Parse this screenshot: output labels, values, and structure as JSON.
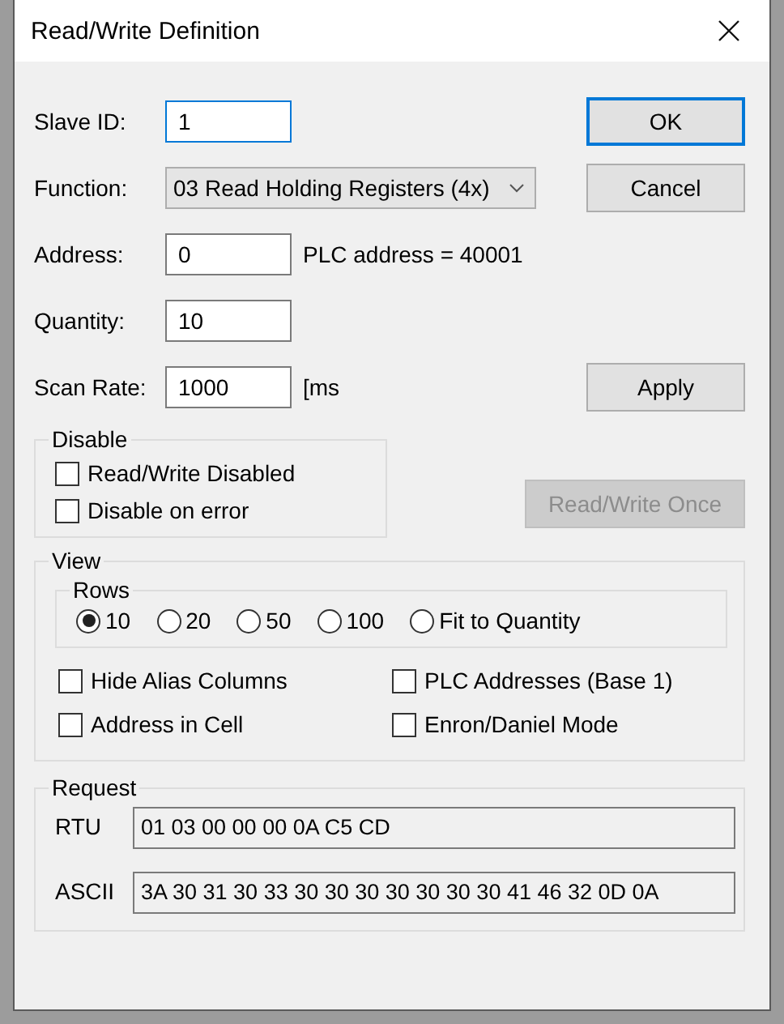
{
  "window": {
    "title": "Read/Write Definition"
  },
  "fields": [
    {
      "label": "Slave ID:",
      "kind": "text",
      "value": "1",
      "focused": true,
      "button": {
        "label": "OK",
        "default": true
      }
    },
    {
      "label": "Function:",
      "kind": "select",
      "value": "03 Read Holding Registers (4x)",
      "button": {
        "label": "Cancel",
        "default": false
      }
    },
    {
      "label": "Address:",
      "kind": "text",
      "value": "0",
      "note": "PLC address = 40001"
    },
    {
      "label": "Quantity:",
      "kind": "text",
      "value": "10"
    },
    {
      "label": "Scan Rate:",
      "kind": "text",
      "value": "1000",
      "note": "[ms",
      "button": {
        "label": "Apply",
        "default": false
      }
    }
  ],
  "disable": {
    "title": "Disable",
    "options": [
      {
        "label": "Read/Write Disabled",
        "checked": false
      },
      {
        "label": "Disable on error",
        "checked": false
      }
    ],
    "button": {
      "label": "Read/Write Once",
      "disabled": true
    }
  },
  "view": {
    "title": "View",
    "rows": {
      "title": "Rows",
      "options": [
        {
          "label": "10",
          "selected": true
        },
        {
          "label": "20",
          "selected": false
        },
        {
          "label": "50",
          "selected": false
        },
        {
          "label": "100",
          "selected": false
        },
        {
          "label": "Fit to Quantity",
          "selected": false
        }
      ]
    },
    "options": [
      {
        "label": "Hide Alias Columns",
        "checked": false
      },
      {
        "label": "PLC Addresses (Base 1)",
        "checked": false
      },
      {
        "label": "Address in Cell",
        "checked": false
      },
      {
        "label": "Enron/Daniel Mode",
        "checked": false
      }
    ]
  },
  "request": {
    "title": "Request",
    "lines": [
      {
        "label": "RTU",
        "value": "01 03 00 00 00 0A C5 CD"
      },
      {
        "label": "ASCII",
        "value": "3A 30 31 30 33 30 30 30 30 30 30 30 41 46 32 0D 0A"
      }
    ]
  }
}
